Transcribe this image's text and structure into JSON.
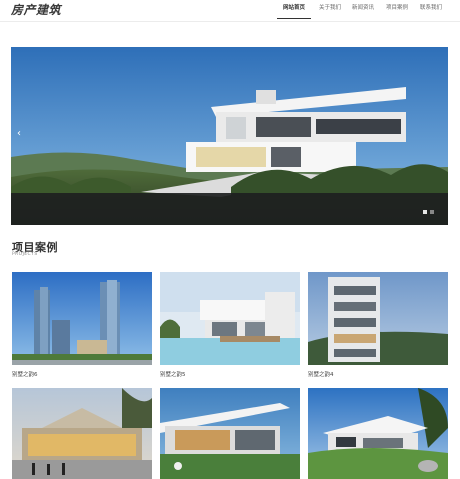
{
  "header": {
    "logo": "房产建筑",
    "nav": [
      {
        "label": "网站首页",
        "active": true
      },
      {
        "label": "关于我们",
        "active": false
      },
      {
        "label": "新闻资讯",
        "active": false
      },
      {
        "label": "项目案例",
        "active": false
      },
      {
        "label": "联系我们",
        "active": false
      }
    ]
  },
  "banner": {
    "prev_icon": "chevron-left-icon",
    "prev_glyph": "‹",
    "dots": 2,
    "active_dot": 1
  },
  "section": {
    "title": "项目案例",
    "subtitle": "PROJECTS"
  },
  "projects": [
    {
      "caption": "别墅之韵6"
    },
    {
      "caption": "别墅之韵5"
    },
    {
      "caption": "别墅之韵4"
    },
    {
      "caption": ""
    },
    {
      "caption": ""
    },
    {
      "caption": ""
    }
  ]
}
